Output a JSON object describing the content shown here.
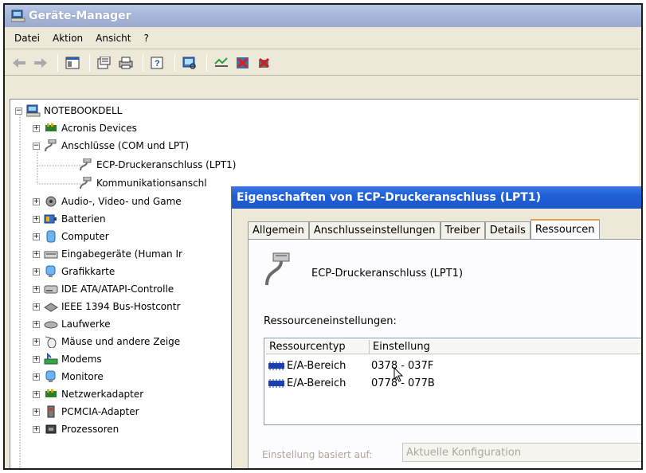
{
  "window": {
    "title": "Geräte-Manager"
  },
  "menu": [
    {
      "label": "Datei"
    },
    {
      "label": "Aktion"
    },
    {
      "label": "Ansicht"
    },
    {
      "label": "?"
    }
  ],
  "tree": {
    "root": "NOTEBOOKDELL",
    "items": [
      {
        "label": "Acronis Devices",
        "icon": "chip-board-icon",
        "expander": "+"
      },
      {
        "label": "Anschlüsse (COM und LPT)",
        "icon": "port-connector-icon",
        "expander": "−"
      },
      {
        "label": "ECP-Druckeranschluss (LPT1)",
        "icon": "port-connector-icon",
        "expander": ""
      },
      {
        "label": "Kommunikationsanschl",
        "icon": "port-connector-icon",
        "expander": ""
      },
      {
        "label": "Audio-, Video- und Game",
        "icon": "speaker-icon",
        "expander": "+"
      },
      {
        "label": "Batterien",
        "icon": "battery-icon",
        "expander": "+"
      },
      {
        "label": "Computer",
        "icon": "computer-icon",
        "expander": "+"
      },
      {
        "label": "Eingabegeräte (Human Ir",
        "icon": "keyboard-icon",
        "expander": "+"
      },
      {
        "label": "Grafikkarte",
        "icon": "monitor-icon",
        "expander": "+"
      },
      {
        "label": "IDE ATA/ATAPI-Controlle",
        "icon": "drive-icon",
        "expander": "+"
      },
      {
        "label": "IEEE 1394 Bus-Hostcontr",
        "icon": "firewire-icon",
        "expander": "+"
      },
      {
        "label": "Laufwerke",
        "icon": "disk-drive-icon",
        "expander": "+"
      },
      {
        "label": "Mäuse und andere Zeige",
        "icon": "mouse-icon",
        "expander": "+"
      },
      {
        "label": "Modems",
        "icon": "modem-icon",
        "expander": "+"
      },
      {
        "label": "Monitore",
        "icon": "monitor-icon",
        "expander": "+"
      },
      {
        "label": "Netzwerkadapter",
        "icon": "network-card-icon",
        "expander": "+"
      },
      {
        "label": "PCMCIA-Adapter",
        "icon": "pcmcia-icon",
        "expander": "+"
      },
      {
        "label": "Prozessoren",
        "icon": "processor-icon",
        "expander": "+"
      }
    ]
  },
  "dialog": {
    "title": "Eigenschaften von ECP-Druckeranschluss (LPT1)",
    "tabs": [
      "Allgemein",
      "Anschlusseinstellungen",
      "Treiber",
      "Details",
      "Ressourcen"
    ],
    "active_tab": "Ressourcen",
    "device_name": "ECP-Druckeranschluss (LPT1)",
    "resource_settings_label": "Ressourceneinstellungen:",
    "columns": [
      "Ressourcentyp",
      "Einstellung"
    ],
    "resources": [
      {
        "type": "E/A-Bereich",
        "setting": "0378 - 037F"
      },
      {
        "type": "E/A-Bereich",
        "setting": "0778 - 077B"
      }
    ],
    "based_on_label": "Einstellung basiert auf:",
    "based_on_value": "Aktuelle Konfiguration"
  }
}
